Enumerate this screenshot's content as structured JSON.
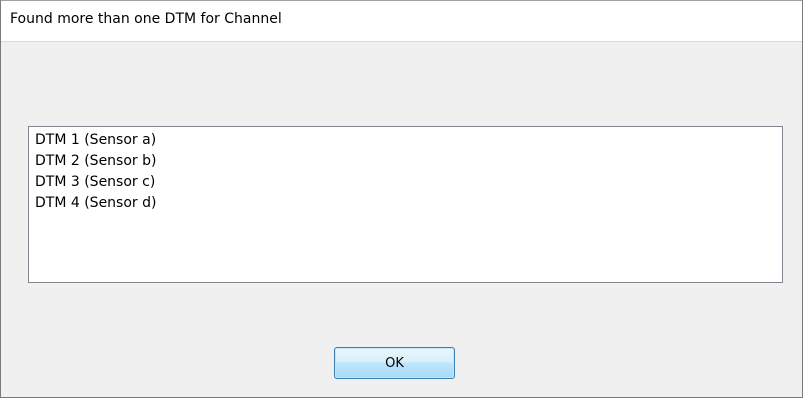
{
  "dialog": {
    "title": "Found more than one DTM for Channel",
    "list": {
      "items": [
        {
          "label": "DTM 1 (Sensor a)"
        },
        {
          "label": "DTM 2 (Sensor b)"
        },
        {
          "label": "DTM 3 (Sensor c)"
        },
        {
          "label": "DTM 4 (Sensor d)"
        }
      ]
    },
    "ok_label": "OK"
  }
}
